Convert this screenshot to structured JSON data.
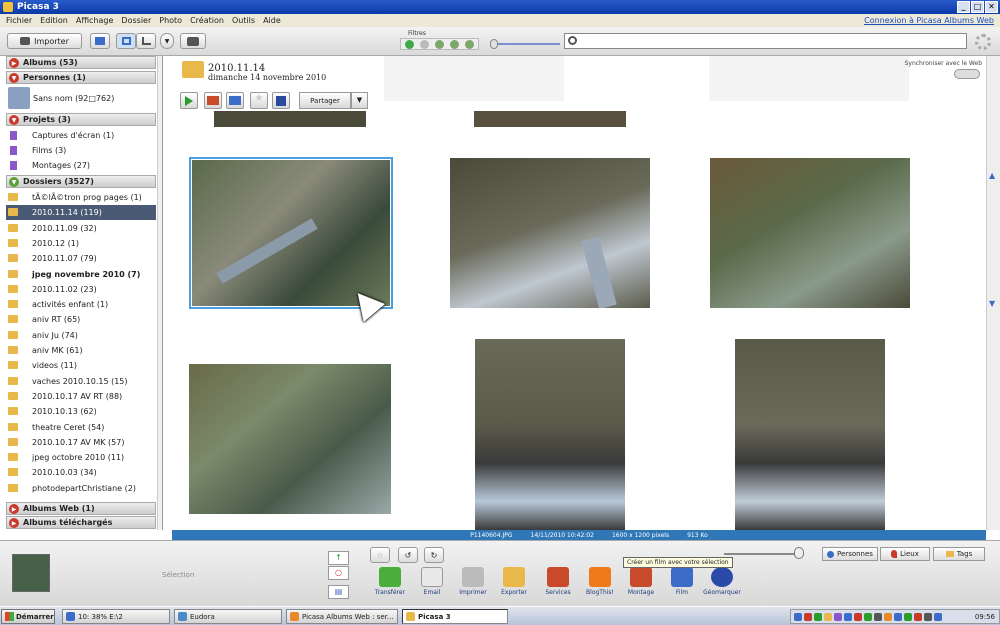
{
  "window": {
    "title": "Picasa 3",
    "controls": [
      "_",
      "□",
      "✕"
    ]
  },
  "menu": {
    "items": [
      "Fichier",
      "Edition",
      "Affichage",
      "Dossier",
      "Photo",
      "Création",
      "Outils",
      "Aide"
    ],
    "link": "Connexion à Picasa Albums Web"
  },
  "toolbar": {
    "import_label": "Importer",
    "filters_label": "Filtres"
  },
  "sidebar": {
    "sections": [
      {
        "label": "Albums (53)",
        "state": "collapsed",
        "color": "#c83a2a"
      },
      {
        "label": "Personnes (1)",
        "state": "expanded",
        "color": "#c83a2a"
      },
      {
        "label": "Projets (3)",
        "state": "expanded",
        "color": "#c83a2a"
      },
      {
        "label": "Dossiers (3527)",
        "state": "expanded",
        "color": "#5a9e3a"
      },
      {
        "label": "Albums Web (1)",
        "state": "collapsed",
        "color": "#c83a2a"
      },
      {
        "label": "Albums téléchargés",
        "state": "collapsed",
        "color": "#c83a2a"
      }
    ],
    "person": "Sans nom (92□762)",
    "projects": [
      "Captures d'écran (1)",
      "Films (3)",
      "Montages (27)"
    ],
    "folders": [
      "tÃ©lÃ©tron prog pages (1)",
      "2010.11.14 (119)",
      "2010.11.09 (32)",
      "2010.12 (1)",
      "2010.11.07 (79)",
      "jpeg novembre 2010 (7)",
      "2010.11.02 (23)",
      "activités enfant (1)",
      "aniv RT (65)",
      "aniv Ju (74)",
      "aniv MK (61)",
      "videos (11)",
      "vaches 2010.10.15 (15)",
      "2010.10.17 AV RT (88)",
      "2010.10.13 (62)",
      "theatre Ceret (54)",
      "2010.10.17 AV MK (57)",
      "jpeg octobre 2010 (11)",
      "2010.10.03 (34)",
      "photodepartChristiane (2)"
    ],
    "selected_folder": "2010.11.14 (119)",
    "bold_folder": "jpeg novembre 2010 (7)"
  },
  "album": {
    "title": "2010.11.14",
    "date": "dimanche 14 novembre 2010",
    "sync_label": "Synchroniser avec le Web",
    "share_label": "Partager"
  },
  "status": {
    "filename": "P1140604.JPG",
    "datetime": "14/11/2010 10:42:02",
    "dimensions": "1600 x 1200 pixels",
    "size": "913 Ko"
  },
  "tray": {
    "selection_label": "Sélection",
    "tooltip": "Créer un film avec votre sélection",
    "actions": [
      "Transférer",
      "Email",
      "Imprimer",
      "Exporter",
      "Services",
      "BlogThis!",
      "Montage",
      "Film",
      "Géomarquer"
    ],
    "tabs": [
      "Personnes",
      "Lieux",
      "Tags"
    ]
  },
  "taskbar": {
    "start": "Démarrer",
    "tasks": [
      "10: 38% E:\\2",
      "Eudora",
      "Picasa Albums Web : ser...",
      "Picasa 3"
    ],
    "active_task": "Picasa 3",
    "clock": "09:56"
  },
  "colors": {
    "title_bar": "#1f52c0",
    "selection": "#4b5a74",
    "status_bar": "#2f77b7",
    "photo_highlight": "#4a9fe0"
  }
}
